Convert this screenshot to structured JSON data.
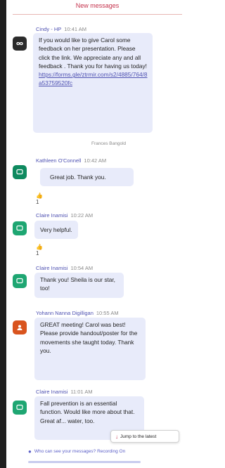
{
  "banner": {
    "new_messages": "New messages"
  },
  "messages": [
    {
      "sender": "Cindy - HP",
      "time": "10:41 AM",
      "text": "If you would like to give Carol some feedback on her presentation. Please click the link. We appreciate any and all feedback . Thank you for having us today!",
      "link": "https://forms.gle/ztrmir.com/s2/4885/764/8a53759520fc",
      "avatar_color": "#2b2b2b",
      "avatar_icon": "infinity-logo-icon"
    },
    {
      "sender": "Kathleen O'Connell",
      "time": "10:42 AM",
      "text": "Great job. Thank you.",
      "reaction": {
        "emoji": "thumbs-up-icon",
        "count": "1"
      },
      "avatar_color": "#0e8a5f",
      "avatar_icon": "chat-bubble-icon"
    },
    {
      "sender": "Claire Inamisi",
      "time": "10:22 AM",
      "text": "Very helpful.",
      "reaction": {
        "emoji": "thumbs-up-icon",
        "count": "1"
      },
      "avatar_color": "#1ea672",
      "avatar_icon": "chat-bubble-icon"
    },
    {
      "sender": "Claire Inamisi",
      "time": "10:54 AM",
      "text": "Thank you! Sheila is our star, too!",
      "avatar_color": "#1ea672",
      "avatar_icon": "chat-bubble-icon"
    },
    {
      "sender": "Yohann Nanna Digilligan",
      "time": "10:55 AM",
      "text": "GREAT meeting! Carol was best! Please provide handout/poster for the movements she taught today. Thank you.",
      "avatar_color": "#d9541e",
      "avatar_icon": "user-initials-icon"
    },
    {
      "sender": "Claire Inamisi",
      "time": "11:01 AM",
      "text": "Fall prevention is an essential function. Would like more about that. Great af... water, too.",
      "avatar_color": "#1ea672",
      "avatar_icon": "chat-bubble-icon"
    }
  ],
  "divider": {
    "label": "Frances Bangold"
  },
  "jump": {
    "label": "Jump to the latest"
  },
  "compose": {
    "prompt": "Who can see your messages? Recording On"
  }
}
